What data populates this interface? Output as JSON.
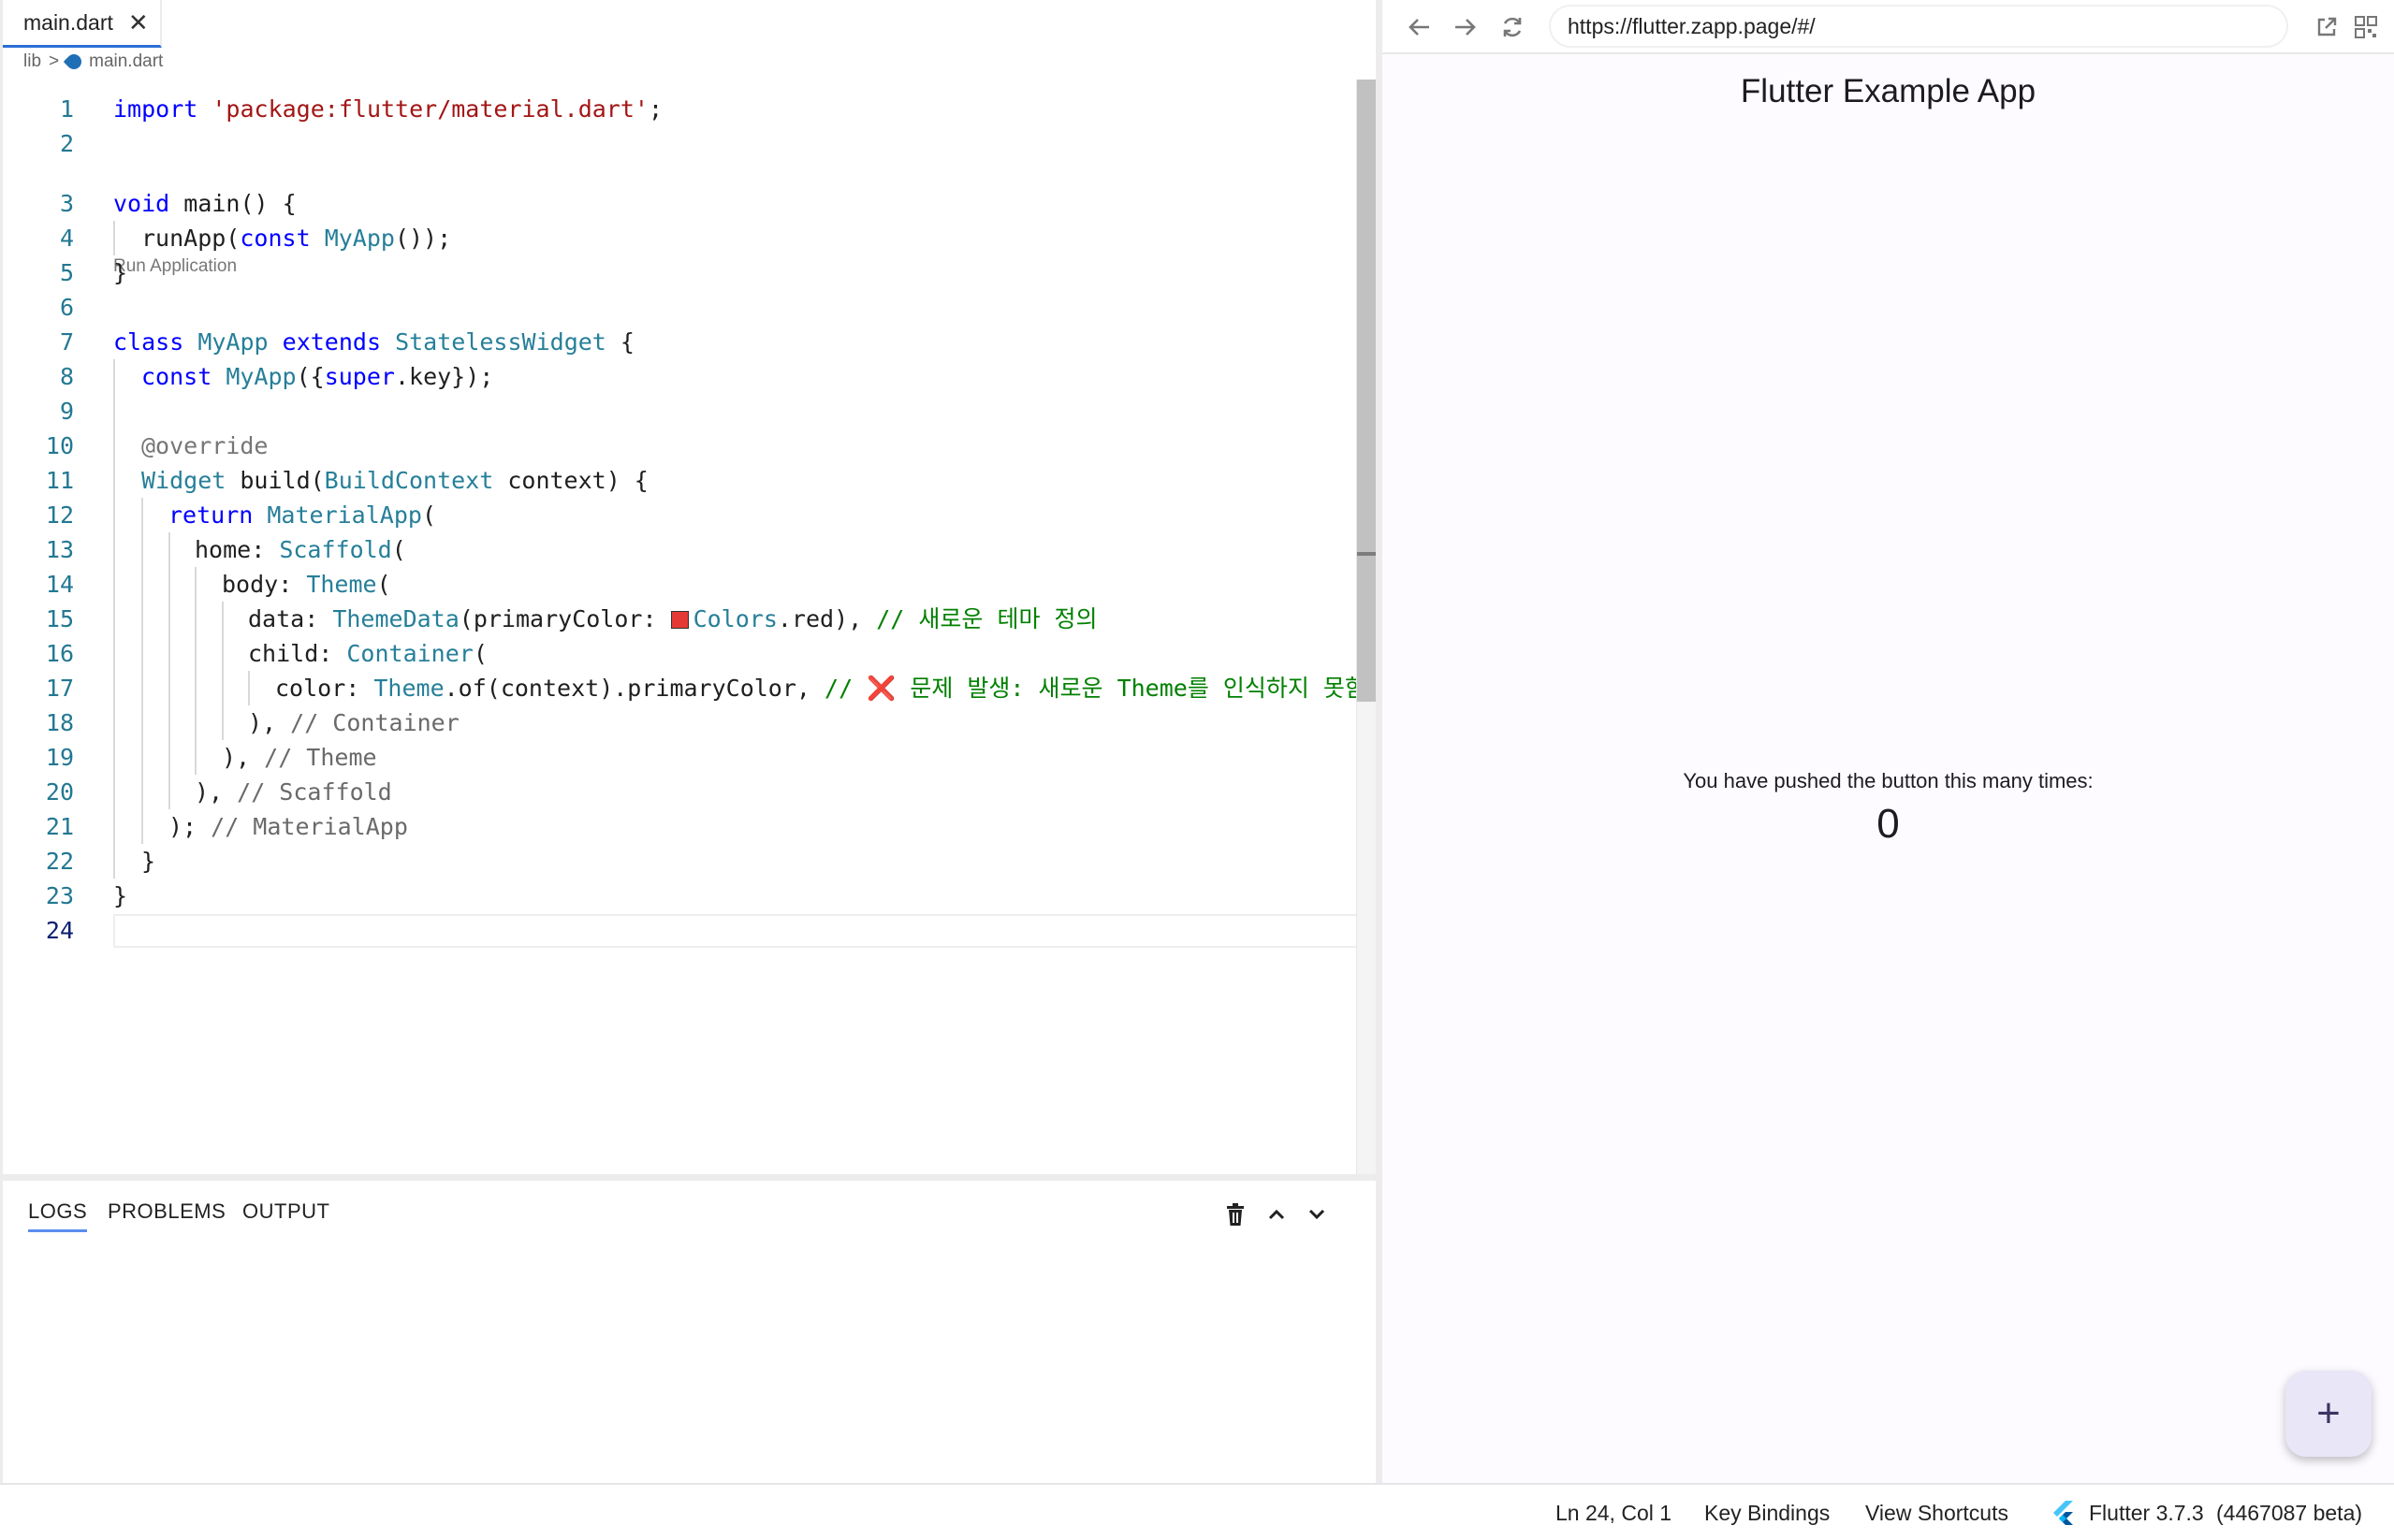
{
  "editor": {
    "tab": {
      "label": "main.dart",
      "close_icon": "close-icon"
    },
    "breadcrumb": {
      "folder": "lib",
      "separator": ">",
      "file": "main.dart"
    },
    "codelens": "Run Application",
    "lines": [
      {
        "n": "1"
      },
      {
        "n": "2"
      },
      {
        "n": "3"
      },
      {
        "n": "4"
      },
      {
        "n": "5"
      },
      {
        "n": "6"
      },
      {
        "n": "7"
      },
      {
        "n": "8"
      },
      {
        "n": "9"
      },
      {
        "n": "10"
      },
      {
        "n": "11"
      },
      {
        "n": "12"
      },
      {
        "n": "13"
      },
      {
        "n": "14"
      },
      {
        "n": "15"
      },
      {
        "n": "16"
      },
      {
        "n": "17"
      },
      {
        "n": "18"
      },
      {
        "n": "19"
      },
      {
        "n": "20"
      },
      {
        "n": "21"
      },
      {
        "n": "22"
      },
      {
        "n": "23"
      },
      {
        "n": "24"
      }
    ],
    "code": {
      "l1": [
        "import",
        " ",
        "'package:flutter/material.dart'",
        ";"
      ],
      "l3": [
        "void",
        " main() {"
      ],
      "l4": [
        "runApp(",
        "const",
        " ",
        "MyApp",
        "());"
      ],
      "l5": "}",
      "l7": [
        "class",
        " ",
        "MyApp",
        " ",
        "extends",
        " ",
        "StatelessWidget",
        " {"
      ],
      "l8": [
        "const",
        " ",
        "MyApp",
        "({",
        "super",
        ".key});"
      ],
      "l10": "@override",
      "l11": [
        "Widget",
        " build(",
        "BuildContext",
        " context) {"
      ],
      "l12": [
        "return",
        " ",
        "MaterialApp",
        "("
      ],
      "l13": [
        "home: ",
        "Scaffold",
        "("
      ],
      "l14": [
        "body: ",
        "Theme",
        "("
      ],
      "l15": [
        "data: ",
        "ThemeData",
        "(primaryColor: ",
        "Colors",
        ".red), ",
        "// 새로운 테마 정의"
      ],
      "l16": [
        "child: ",
        "Container",
        "("
      ],
      "l17": [
        "color: ",
        "Theme",
        ".of(context).primaryColor, ",
        "// ",
        "❌",
        " 문제 발생: 새로운 Theme를 인식하지 못함"
      ],
      "l18": [
        "), ",
        "// Container"
      ],
      "l19": [
        "), ",
        "// Theme"
      ],
      "l20": [
        "), ",
        "// Scaffold"
      ],
      "l21": [
        "); ",
        "// MaterialApp"
      ],
      "l22": "}",
      "l23": "}"
    },
    "colors": {
      "keyword": "#0000ff",
      "type": "#267f99",
      "string": "#a31515",
      "comment": "#008000",
      "swatch": "#e53935"
    }
  },
  "panel": {
    "tabs": [
      "LOGS",
      "PROBLEMS",
      "OUTPUT"
    ],
    "icons": [
      "trash-icon",
      "chevron-up-icon",
      "chevron-down-icon"
    ]
  },
  "preview": {
    "url": "https://flutter.zapp.page/#/",
    "app_title": "Flutter Example App",
    "counter_label": "You have pushed the button this many times:",
    "counter_value": "0",
    "fab_label": "+"
  },
  "status": {
    "position": "Ln 24, Col 1",
    "key_bindings": "Key Bindings",
    "shortcuts": "View Shortcuts",
    "flutter_version": "Flutter 3.7.3",
    "flutter_build": "(4467087 beta)"
  }
}
